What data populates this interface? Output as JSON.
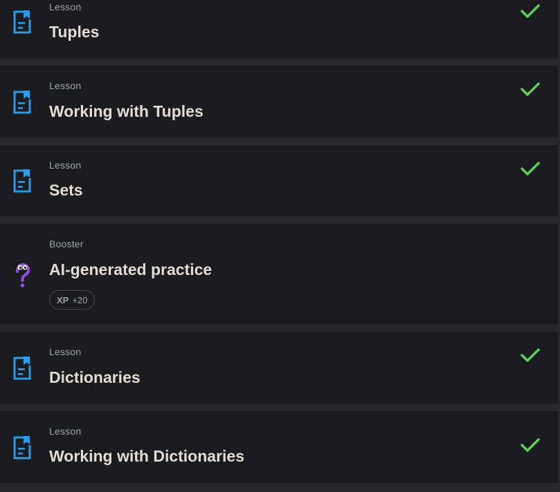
{
  "items": [
    {
      "kind": "Lesson",
      "title": "Tuples",
      "icon": "lesson-document-icon",
      "completed": true
    },
    {
      "kind": "Lesson",
      "title": "Working with Tuples",
      "icon": "lesson-document-icon",
      "completed": true
    },
    {
      "kind": "Lesson",
      "title": "Sets",
      "icon": "lesson-document-icon",
      "completed": true
    },
    {
      "kind": "Booster",
      "title": "AI-generated practice",
      "icon": "question-mascot-icon",
      "xp_label": "XP",
      "xp_value": "+20",
      "completed": false
    },
    {
      "kind": "Lesson",
      "title": "Dictionaries",
      "icon": "lesson-document-icon",
      "completed": true
    },
    {
      "kind": "Lesson",
      "title": "Working with Dictionaries",
      "icon": "lesson-document-icon",
      "completed": true
    }
  ],
  "colors": {
    "background": "#28292d",
    "card": "#1b1c1f",
    "accent_blue": "#2d9be8",
    "check_green": "#5fd35a",
    "booster_purple": "#8e4fe0",
    "title_text": "#e4dbd2",
    "kind_text": "#9fa3a8"
  }
}
